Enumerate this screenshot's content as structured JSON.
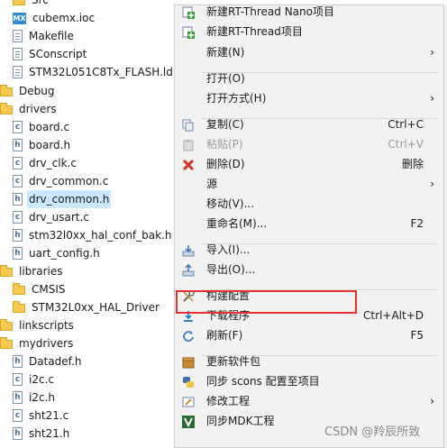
{
  "tree": [
    {
      "label": "Src",
      "icon": "folder-icon"
    },
    {
      "label": "cubemx.ioc",
      "icon": "mx-file-icon"
    },
    {
      "label": "Makefile",
      "icon": "file-icon"
    },
    {
      "label": "SConscript",
      "icon": "file-icon"
    },
    {
      "label": "STM32L051C8Tx_FLASH.ld",
      "icon": "file-icon"
    },
    {
      "label": "Debug",
      "icon": "folder-icon"
    },
    {
      "label": "drivers",
      "icon": "folder-icon"
    },
    {
      "label": "board.c",
      "icon": "c-file-icon"
    },
    {
      "label": "board.h",
      "icon": "h-file-icon"
    },
    {
      "label": "drv_clk.c",
      "icon": "c-file-icon"
    },
    {
      "label": "drv_common.c",
      "icon": "c-file-icon"
    },
    {
      "label": "drv_common.h",
      "icon": "h-file-icon",
      "selected": true
    },
    {
      "label": "drv_usart.c",
      "icon": "c-file-icon"
    },
    {
      "label": "stm32l0xx_hal_conf_bak.h",
      "icon": "h-file-icon"
    },
    {
      "label": "uart_config.h",
      "icon": "h-file-icon"
    },
    {
      "label": "libraries",
      "icon": "folder-icon"
    },
    {
      "label": "CMSIS",
      "icon": "folder-icon"
    },
    {
      "label": "STM32L0xx_HAL_Driver",
      "icon": "folder-icon"
    },
    {
      "label": "linkscripts",
      "icon": "folder-icon"
    },
    {
      "label": "mydrivers",
      "icon": "folder-icon"
    },
    {
      "label": "Datadef.h",
      "icon": "h-file-icon"
    },
    {
      "label": "i2c.c",
      "icon": "c-file-icon"
    },
    {
      "label": "i2c.h",
      "icon": "h-file-icon"
    },
    {
      "label": "sht21.c",
      "icon": "c-file-icon"
    },
    {
      "label": "sht21.h",
      "icon": "h-file-icon"
    }
  ],
  "menu": [
    {
      "label": "新建RT-Thread Nano项目",
      "icon": "new-project-icon"
    },
    {
      "label": "新建RT-Thread项目",
      "icon": "new-project-icon"
    },
    {
      "label": "新建(N)",
      "submenu": true
    },
    {
      "label": "打开(O)"
    },
    {
      "label": "打开方式(H)",
      "submenu": true
    },
    {
      "label": "复制(C)",
      "shortcut": "Ctrl+C",
      "icon": "copy-icon"
    },
    {
      "label": "粘贴(P)",
      "shortcut": "Ctrl+V",
      "icon": "paste-icon",
      "disabled": true
    },
    {
      "label": "删除(D)",
      "shortcut": "删除",
      "icon": "delete-icon"
    },
    {
      "label": "源",
      "submenu": true
    },
    {
      "label": "移动(V)..."
    },
    {
      "label": "重命名(M)...",
      "shortcut": "F2"
    },
    {
      "label": "导入(I)...",
      "icon": "import-icon"
    },
    {
      "label": "导出(O)...",
      "icon": "export-icon"
    },
    {
      "label": "构建配置",
      "icon": "build-config-icon"
    },
    {
      "label": "下载程序",
      "shortcut": "Ctrl+Alt+D",
      "icon": "download-icon"
    },
    {
      "label": "刷新(F)",
      "shortcut": "F5",
      "icon": "refresh-icon"
    },
    {
      "label": "更新软件包",
      "icon": "package-icon"
    },
    {
      "label": "同步 scons 配置至项目",
      "icon": "python-icon"
    },
    {
      "label": "修改工程",
      "icon": "edit-project-icon",
      "submenu": true
    },
    {
      "label": "同步MDK工程",
      "icon": "mdk-icon"
    }
  ],
  "arrow_glyph": "›",
  "watermark": "CSDN @羚辰所致",
  "colors": {
    "highlight": "#e53333",
    "selection": "#cce8ff",
    "menu_bg": "#f2f2f2"
  }
}
